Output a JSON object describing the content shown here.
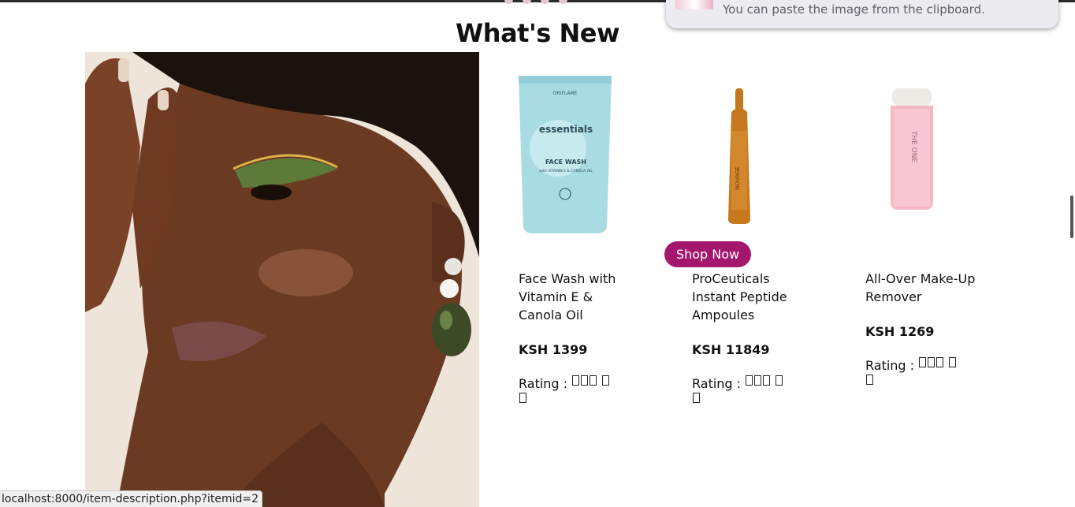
{
  "section": {
    "title": "What's New"
  },
  "paste_popup": {
    "text": "You can paste the image from the clipboard."
  },
  "products": [
    {
      "name": "Face Wash with Vitamin E & Canola Oil",
      "price": "KSH 1399",
      "rating_label": "Rating :"
    },
    {
      "name": "ProCeuticals Instant Peptide Ampoules",
      "price": "KSH 11849",
      "rating_label": "Rating :"
    },
    {
      "name": "All-Over Make-Up Remover",
      "price": "KSH 1269",
      "rating_label": "Rating :"
    }
  ],
  "shop_button": {
    "label": "Shop Now"
  },
  "status": {
    "url": "localhost:8000/item-description.php?itemid=2"
  },
  "colors": {
    "accent": "#a3176f",
    "tube": "#a9dbe3",
    "ampoule": "#c6781f",
    "bottle": "#f6b7c7"
  },
  "product_labels": {
    "tube_brand": "ORIFLAME",
    "tube_line": "essentials",
    "tube_product": "FACE WASH",
    "tube_sub": "with VITAMIN E & CANOLA OIL",
    "ampoule_brand": "NOVAGE",
    "bottle_brand": "THE ONE"
  }
}
